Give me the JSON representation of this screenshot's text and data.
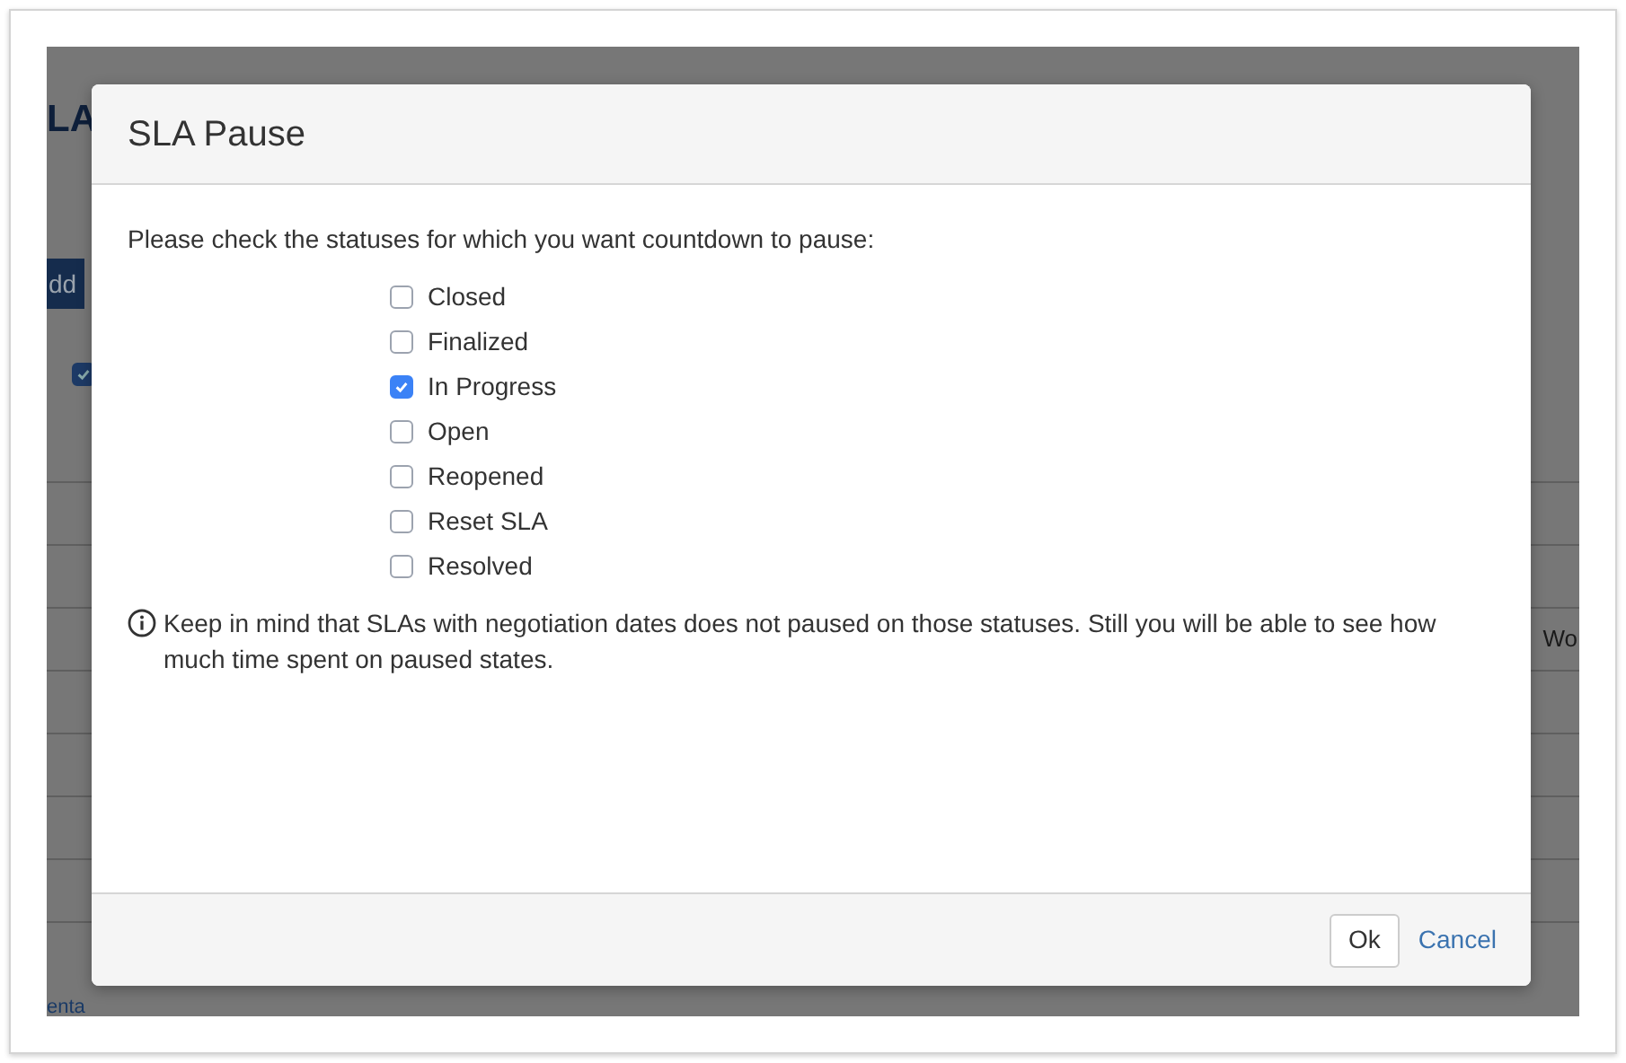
{
  "background": {
    "heading": "LA",
    "add_button": "dd",
    "checkbox": {
      "checked": true
    },
    "row_text": "Wo",
    "link": "enta"
  },
  "dialog": {
    "title": "SLA Pause",
    "prompt": "Please check the statuses for which you want countdown to pause:",
    "statuses": [
      {
        "label": "Closed",
        "checked": false
      },
      {
        "label": "Finalized",
        "checked": false
      },
      {
        "label": "In Progress",
        "checked": true
      },
      {
        "label": "Open",
        "checked": false
      },
      {
        "label": "Reopened",
        "checked": false
      },
      {
        "label": "Reset SLA",
        "checked": false
      },
      {
        "label": "Resolved",
        "checked": false
      }
    ],
    "note": "Keep in mind that SLAs with negotiation dates does not paused on those statuses. Still you will be able to see how much time spent on paused states.",
    "ok_button": "Ok",
    "cancel_link": "Cancel"
  }
}
